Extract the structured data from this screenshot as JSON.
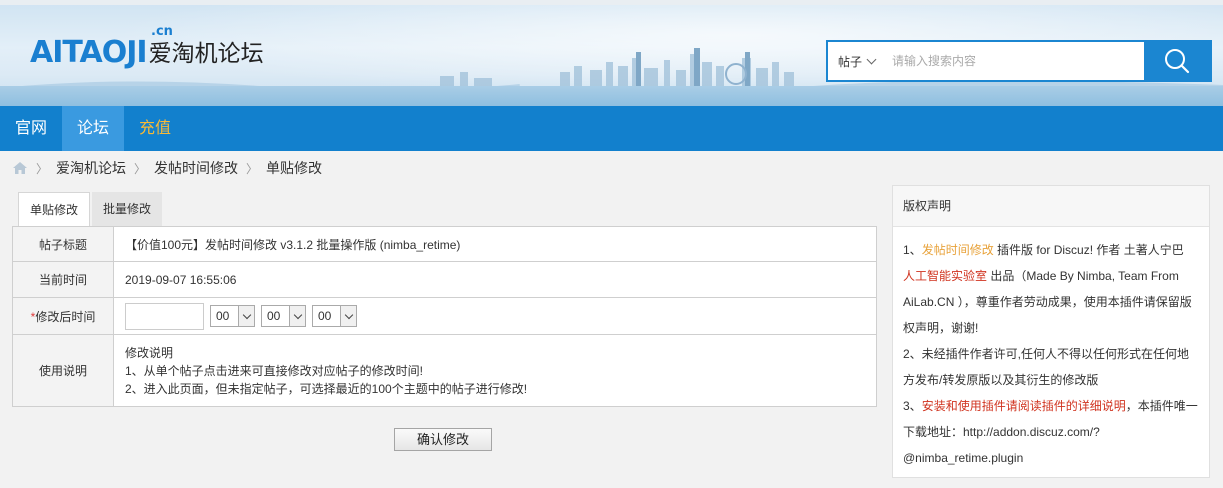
{
  "header": {
    "logo_en": "AITAOJI",
    "logo_suffix": ".cn",
    "logo_cn": "爱淘机论坛",
    "search": {
      "type_label": "帖子",
      "placeholder": "请输入搜索内容",
      "button_icon": "search-icon"
    }
  },
  "nav": {
    "items": [
      {
        "label": "官网"
      },
      {
        "label": "论坛"
      },
      {
        "label": "充值"
      }
    ],
    "active": "论坛",
    "colors": {
      "bar": "#1280cd",
      "active": "#3a9ae0",
      "recharge": "#f8b936"
    }
  },
  "breadcrumb": {
    "home_icon": "home-icon",
    "items": [
      "爱淘机论坛",
      "发帖时间修改",
      "单贴修改"
    ]
  },
  "tabs": {
    "items": [
      {
        "label": "单贴修改"
      },
      {
        "label": "批量修改"
      }
    ],
    "active": "单贴修改"
  },
  "form": {
    "rows": {
      "title": {
        "label": "帖子标题",
        "value": "【价值100元】发帖时间修改 v3.1.2 批量操作版 (nimba_retime)"
      },
      "current": {
        "label": "当前时间",
        "value": "2019-09-07 16:55:06"
      },
      "modified": {
        "required_mark": "*",
        "label": "修改后时间",
        "date_value": "",
        "hour": "00",
        "minute": "00",
        "second": "00"
      },
      "usage": {
        "label": "使用说明",
        "lines": [
          "修改说明",
          "1、从单个帖子点击进来可直接修改对应帖子的修改时间!",
          "2、进入此页面，但未指定帖子，可选择最近的100个主题中的帖子进行修改!"
        ]
      }
    },
    "submit_label": "确认修改"
  },
  "copyright": {
    "title": "版权声明",
    "p1": {
      "prefix": "1、",
      "link1": "发帖时间修改",
      "text1": " 插件版 for Discuz! 作者 土著人宁巴 ",
      "link2": "人工智能实验室",
      "text2": " 出品（Made By Nimba, Team From AiLab.CN ），尊重作者劳动成果，使用本插件请保留版权声明，谢谢!"
    },
    "p2": "2、未经插件作者许可,任何人不得以任何形式在任何地方发布/转发原版以及其衍生的修改版",
    "p3": {
      "prefix": "3、",
      "link": "安装和使用插件请阅读插件的详细说明",
      "text": "，本插件唯一下载地址：http://addon.discuz.com/?@nimba_retime.plugin"
    },
    "colors": {
      "orange": "#e8a23a",
      "red": "#d0331f"
    }
  }
}
